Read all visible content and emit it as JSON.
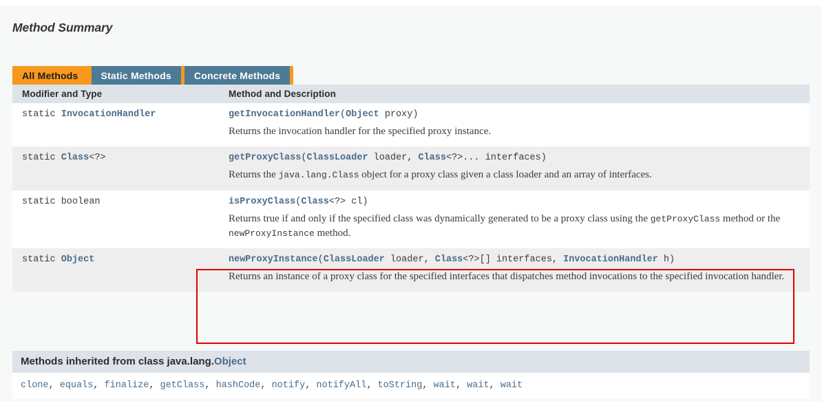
{
  "section": {
    "title": "Method Summary"
  },
  "tabs": [
    {
      "label": "All Methods",
      "state": "active"
    },
    {
      "label": "Static Methods",
      "state": "inactive"
    },
    {
      "label": "Concrete Methods",
      "state": "inactive"
    }
  ],
  "table": {
    "headers": [
      "Modifier and Type",
      "Method and Description"
    ],
    "rows": [
      {
        "modifier_prefix": "static ",
        "modifier_type": "InvocationHandler",
        "modifier_suffix": "",
        "method_name": "getInvocationHandler",
        "signature_parts": [
          {
            "text": "(",
            "style": "plain"
          },
          {
            "text": "Object",
            "style": "link"
          },
          {
            "text": " proxy)",
            "style": "plain"
          }
        ],
        "description_parts": [
          {
            "text": "Returns the invocation handler for the specified proxy instance.",
            "style": "text"
          }
        ]
      },
      {
        "modifier_prefix": "static ",
        "modifier_type": "Class",
        "modifier_suffix": "<?>",
        "method_name": "getProxyClass",
        "signature_parts": [
          {
            "text": "(",
            "style": "plain"
          },
          {
            "text": "ClassLoader",
            "style": "link"
          },
          {
            "text": " loader, ",
            "style": "plain"
          },
          {
            "text": "Class",
            "style": "link"
          },
          {
            "text": "<?>... interfaces)",
            "style": "plain"
          }
        ],
        "description_parts": [
          {
            "text": "Returns the ",
            "style": "text"
          },
          {
            "text": "java.lang.Class",
            "style": "mono"
          },
          {
            "text": " object for a proxy class given a class loader and an array of interfaces.",
            "style": "text"
          }
        ]
      },
      {
        "modifier_prefix": "static boolean",
        "modifier_type": "",
        "modifier_suffix": "",
        "method_name": "isProxyClass",
        "signature_parts": [
          {
            "text": "(",
            "style": "plain"
          },
          {
            "text": "Class",
            "style": "link"
          },
          {
            "text": "<?> cl)",
            "style": "plain"
          }
        ],
        "description_parts": [
          {
            "text": "Returns true if and only if the specified class was dynamically generated to be a proxy class using the ",
            "style": "text"
          },
          {
            "text": "getProxyClass",
            "style": "mono"
          },
          {
            "text": " method or the ",
            "style": "text"
          },
          {
            "text": "newProxyInstance",
            "style": "mono"
          },
          {
            "text": " method.",
            "style": "text"
          }
        ]
      },
      {
        "modifier_prefix": "static ",
        "modifier_type": "Object",
        "modifier_suffix": "",
        "method_name": "newProxyInstance",
        "signature_parts": [
          {
            "text": "(",
            "style": "plain"
          },
          {
            "text": "ClassLoader",
            "style": "link"
          },
          {
            "text": " loader, ",
            "style": "plain"
          },
          {
            "text": "Class",
            "style": "link"
          },
          {
            "text": "<?>[] interfaces, ",
            "style": "plain"
          },
          {
            "text": "InvocationHandler",
            "style": "link"
          },
          {
            "text": " h)",
            "style": "plain"
          }
        ],
        "description_parts": [
          {
            "text": "Returns an instance of a proxy class for the specified interfaces that dispatches method invocations to the specified invocation handler.",
            "style": "text"
          }
        ]
      }
    ]
  },
  "inherited": {
    "heading_prefix": "Methods inherited from class java.lang.",
    "heading_link": "Object",
    "methods": [
      "clone",
      "equals",
      "finalize",
      "getClass",
      "hashCode",
      "notify",
      "notifyAll",
      "toString",
      "wait",
      "wait",
      "wait"
    ],
    "separator": ", "
  },
  "annotation": {
    "color": "#dd0000",
    "target_row_index": 3
  },
  "colors": {
    "tab_active_bg": "#f8981d",
    "tab_inactive_bg": "#4d7a96",
    "header_bg": "#dee3e9",
    "link": "#4a6c8a",
    "alt_row_bg": "#eeeeee",
    "page_bg": "#f7f8f8"
  }
}
